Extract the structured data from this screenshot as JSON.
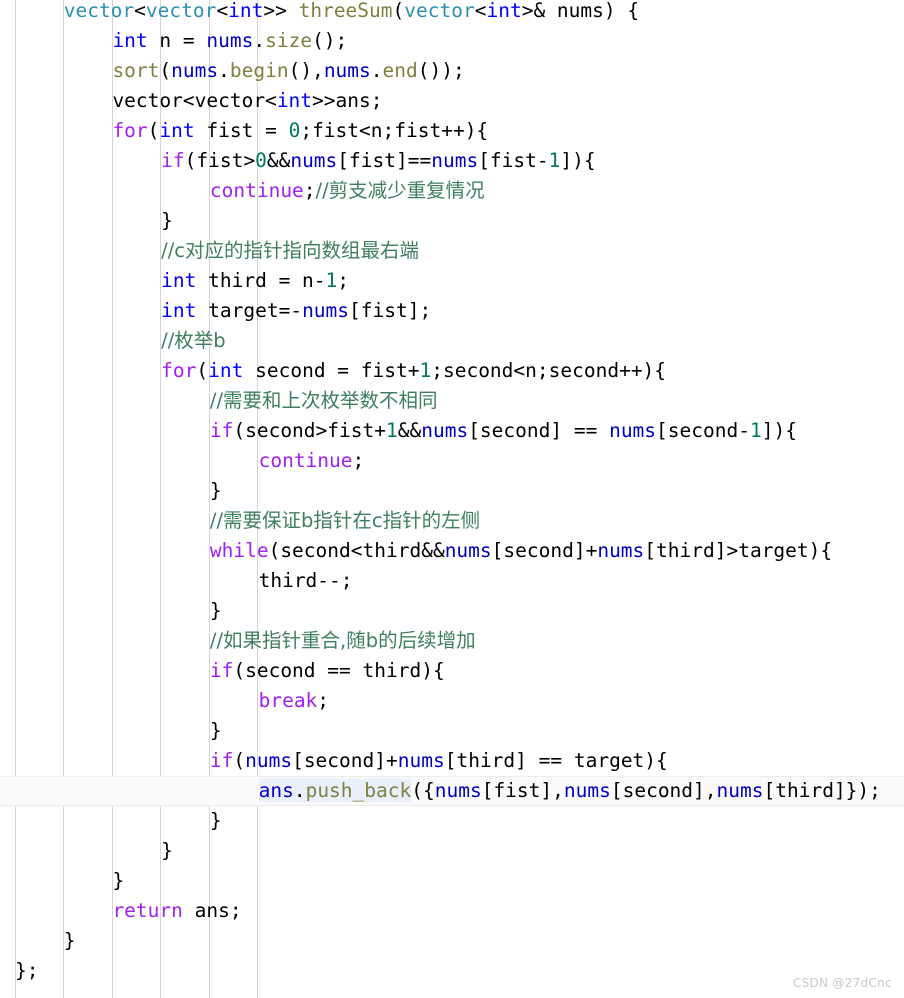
{
  "editor": {
    "language": "C++",
    "background_color": "#ffffff",
    "font_size_px": 19.5,
    "line_height_px": 30,
    "indent_guide_color": "#d4d4d4",
    "current_line_highlight_color": "#fafafa",
    "selection_highlight_color": "#eaf0fb",
    "first_line_clipped": true
  },
  "colors": {
    "keyword": "#a020f0",
    "type": "#0000ff",
    "class": "#2b91af",
    "function": "#7f7f3f",
    "variable": "#0000c0",
    "number": "#007a5e",
    "comment": "#3f7f5f",
    "default": "#000000",
    "watermark": "#c9c9c9"
  },
  "indent_guides": {
    "x_positions": [
      15,
      63,
      112,
      160,
      209,
      257
    ]
  },
  "watermark": {
    "text": "CSDN @27dCnc"
  },
  "code": {
    "plain_text": "    vector<vector<int>> threeSum(vector<int>& nums) {\n        int n = nums.size();\n        sort(nums.begin(),nums.end());\n        vector<vector<int>>ans;\n        for(int fist = 0;fist<n;fist++){\n            if(fist>0&&nums[fist]==nums[fist-1]){\n                continue;//剪支减少重复情况\n            }\n            //c对应的指针指向数组最右端\n            int third = n-1;\n            int target=-nums[fist];\n            //枚举b\n            for(int second = fist+1;second<n;second++){\n                //需要和上次枚举数不相同\n                if(second>fist+1&&nums[second] == nums[second-1]){\n                    continue;\n                }\n                //需要保证b指针在c指针的左侧\n                while(second<third&&nums[second]+nums[third]>target){\n                    third--;\n                }\n                //如果指针重合,随b的后续增加\n                if(second == third){\n                    break;\n                }\n                if(nums[second]+nums[third] == target){\n                    ans.push_back({nums[fist],nums[second],nums[third]});\n                }\n            }\n        }\n        return ans;\n    }\n};",
    "lines": [
      {
        "index": 0,
        "current": false,
        "indent": 4,
        "tokens": [
          {
            "t": "vector",
            "c": "cls"
          },
          {
            "t": "<",
            "c": "pun"
          },
          {
            "t": "vector",
            "c": "cls"
          },
          {
            "t": "<",
            "c": "pun"
          },
          {
            "t": "int",
            "c": "typ"
          },
          {
            "t": ">> ",
            "c": "pun"
          },
          {
            "t": "threeSum",
            "c": "fn"
          },
          {
            "t": "(",
            "c": "pun"
          },
          {
            "t": "vector",
            "c": "cls"
          },
          {
            "t": "<",
            "c": "pun"
          },
          {
            "t": "int",
            "c": "typ"
          },
          {
            "t": ">& nums) {",
            "c": "pun"
          }
        ]
      },
      {
        "index": 1,
        "current": false,
        "indent": 8,
        "tokens": [
          {
            "t": "int",
            "c": "typ"
          },
          {
            "t": " n = ",
            "c": "pun"
          },
          {
            "t": "nums",
            "c": "var"
          },
          {
            "t": ".",
            "c": "pun"
          },
          {
            "t": "size",
            "c": "fn"
          },
          {
            "t": "();",
            "c": "pun"
          }
        ]
      },
      {
        "index": 2,
        "current": false,
        "indent": 8,
        "tokens": [
          {
            "t": "sort",
            "c": "fn"
          },
          {
            "t": "(",
            "c": "pun"
          },
          {
            "t": "nums",
            "c": "var"
          },
          {
            "t": ".",
            "c": "pun"
          },
          {
            "t": "begin",
            "c": "fn"
          },
          {
            "t": "(),",
            "c": "pun"
          },
          {
            "t": "nums",
            "c": "var"
          },
          {
            "t": ".",
            "c": "pun"
          },
          {
            "t": "end",
            "c": "fn"
          },
          {
            "t": "());",
            "c": "pun"
          }
        ]
      },
      {
        "index": 3,
        "current": false,
        "indent": 8,
        "tokens": [
          {
            "t": "vector<vector<",
            "c": "pun"
          },
          {
            "t": "int",
            "c": "typ"
          },
          {
            "t": ">>ans;",
            "c": "pun"
          }
        ]
      },
      {
        "index": 4,
        "current": false,
        "indent": 8,
        "tokens": [
          {
            "t": "for",
            "c": "kw"
          },
          {
            "t": "(",
            "c": "pun"
          },
          {
            "t": "int",
            "c": "typ"
          },
          {
            "t": " fist = ",
            "c": "pun"
          },
          {
            "t": "0",
            "c": "num"
          },
          {
            "t": ";fist<n;fist++){",
            "c": "pun"
          }
        ]
      },
      {
        "index": 5,
        "current": false,
        "indent": 12,
        "tokens": [
          {
            "t": "if",
            "c": "kw"
          },
          {
            "t": "(fist>",
            "c": "pun"
          },
          {
            "t": "0",
            "c": "num"
          },
          {
            "t": "&&",
            "c": "pun"
          },
          {
            "t": "nums",
            "c": "var"
          },
          {
            "t": "[fist]==",
            "c": "pun"
          },
          {
            "t": "nums",
            "c": "var"
          },
          {
            "t": "[fist-",
            "c": "pun"
          },
          {
            "t": "1",
            "c": "num"
          },
          {
            "t": "]){",
            "c": "pun"
          }
        ]
      },
      {
        "index": 6,
        "current": false,
        "indent": 16,
        "tokens": [
          {
            "t": "continue",
            "c": "kw"
          },
          {
            "t": ";",
            "c": "pun"
          },
          {
            "t": "//剪支减少重复情况",
            "c": "cmt"
          }
        ]
      },
      {
        "index": 7,
        "current": false,
        "indent": 12,
        "tokens": [
          {
            "t": "}",
            "c": "pun"
          }
        ]
      },
      {
        "index": 8,
        "current": false,
        "indent": 12,
        "tokens": [
          {
            "t": "//c对应的指针指向数组最右端",
            "c": "cmt"
          }
        ]
      },
      {
        "index": 9,
        "current": false,
        "indent": 12,
        "tokens": [
          {
            "t": "int",
            "c": "typ"
          },
          {
            "t": " third = n-",
            "c": "pun"
          },
          {
            "t": "1",
            "c": "num"
          },
          {
            "t": ";",
            "c": "pun"
          }
        ]
      },
      {
        "index": 10,
        "current": false,
        "indent": 12,
        "tokens": [
          {
            "t": "int",
            "c": "typ"
          },
          {
            "t": " target=-",
            "c": "pun"
          },
          {
            "t": "nums",
            "c": "var"
          },
          {
            "t": "[fist];",
            "c": "pun"
          }
        ]
      },
      {
        "index": 11,
        "current": false,
        "indent": 12,
        "tokens": [
          {
            "t": "//枚举b",
            "c": "cmt"
          }
        ]
      },
      {
        "index": 12,
        "current": false,
        "indent": 12,
        "tokens": [
          {
            "t": "for",
            "c": "kw"
          },
          {
            "t": "(",
            "c": "pun"
          },
          {
            "t": "int",
            "c": "typ"
          },
          {
            "t": " second = fist+",
            "c": "pun"
          },
          {
            "t": "1",
            "c": "num"
          },
          {
            "t": ";second<n;second++){",
            "c": "pun"
          }
        ]
      },
      {
        "index": 13,
        "current": false,
        "indent": 16,
        "tokens": [
          {
            "t": "//需要和上次枚举数不相同",
            "c": "cmt"
          }
        ]
      },
      {
        "index": 14,
        "current": false,
        "indent": 16,
        "tokens": [
          {
            "t": "if",
            "c": "kw"
          },
          {
            "t": "(second>fist+",
            "c": "pun"
          },
          {
            "t": "1",
            "c": "num"
          },
          {
            "t": "&&",
            "c": "pun"
          },
          {
            "t": "nums",
            "c": "var"
          },
          {
            "t": "[second] == ",
            "c": "pun"
          },
          {
            "t": "nums",
            "c": "var"
          },
          {
            "t": "[second-",
            "c": "pun"
          },
          {
            "t": "1",
            "c": "num"
          },
          {
            "t": "]){",
            "c": "pun"
          }
        ]
      },
      {
        "index": 15,
        "current": false,
        "indent": 20,
        "tokens": [
          {
            "t": "continue",
            "c": "kw"
          },
          {
            "t": ";",
            "c": "pun"
          }
        ]
      },
      {
        "index": 16,
        "current": false,
        "indent": 16,
        "tokens": [
          {
            "t": "}",
            "c": "pun"
          }
        ]
      },
      {
        "index": 17,
        "current": false,
        "indent": 16,
        "tokens": [
          {
            "t": "//需要保证b指针在c指针的左侧",
            "c": "cmt"
          }
        ]
      },
      {
        "index": 18,
        "current": false,
        "indent": 16,
        "tokens": [
          {
            "t": "while",
            "c": "kw"
          },
          {
            "t": "(second<third",
            "c": "pun"
          },
          {
            "t": "&&",
            "c": "pun"
          },
          {
            "t": "nums",
            "c": "var"
          },
          {
            "t": "[second]+",
            "c": "pun"
          },
          {
            "t": "nums",
            "c": "var"
          },
          {
            "t": "[third]>target){",
            "c": "pun"
          }
        ]
      },
      {
        "index": 19,
        "current": false,
        "indent": 20,
        "tokens": [
          {
            "t": "third--;",
            "c": "pun"
          }
        ]
      },
      {
        "index": 20,
        "current": false,
        "indent": 16,
        "tokens": [
          {
            "t": "}",
            "c": "pun"
          }
        ]
      },
      {
        "index": 21,
        "current": false,
        "indent": 16,
        "tokens": [
          {
            "t": "//如果指针重合,随b的后续增加",
            "c": "cmt"
          }
        ]
      },
      {
        "index": 22,
        "current": false,
        "indent": 16,
        "tokens": [
          {
            "t": "if",
            "c": "kw"
          },
          {
            "t": "(second == third){",
            "c": "pun"
          }
        ]
      },
      {
        "index": 23,
        "current": false,
        "indent": 20,
        "tokens": [
          {
            "t": "break",
            "c": "kw"
          },
          {
            "t": ";",
            "c": "pun"
          }
        ]
      },
      {
        "index": 24,
        "current": false,
        "indent": 16,
        "tokens": [
          {
            "t": "}",
            "c": "pun"
          }
        ]
      },
      {
        "index": 25,
        "current": false,
        "indent": 16,
        "tokens": [
          {
            "t": "if",
            "c": "kw"
          },
          {
            "t": "(",
            "c": "pun"
          },
          {
            "t": "nums",
            "c": "var"
          },
          {
            "t": "[second]+",
            "c": "pun"
          },
          {
            "t": "nums",
            "c": "var"
          },
          {
            "t": "[third] == target){",
            "c": "pun"
          }
        ]
      },
      {
        "index": 26,
        "current": true,
        "indent": 20,
        "tokens": [
          {
            "t": "ans",
            "c": "var",
            "sel": true
          },
          {
            "t": ".",
            "c": "pun",
            "sel": true
          },
          {
            "t": "push_back",
            "c": "fn",
            "sel": true
          },
          {
            "t": "({",
            "c": "pun"
          },
          {
            "t": "nums",
            "c": "var"
          },
          {
            "t": "[fist],",
            "c": "pun"
          },
          {
            "t": "nums",
            "c": "var"
          },
          {
            "t": "[second],",
            "c": "pun"
          },
          {
            "t": "nums",
            "c": "var"
          },
          {
            "t": "[third]});",
            "c": "pun"
          }
        ]
      },
      {
        "index": 27,
        "current": false,
        "indent": 16,
        "tokens": [
          {
            "t": "}",
            "c": "pun"
          }
        ]
      },
      {
        "index": 28,
        "current": false,
        "indent": 12,
        "tokens": [
          {
            "t": "}",
            "c": "pun"
          }
        ]
      },
      {
        "index": 29,
        "current": false,
        "indent": 8,
        "tokens": [
          {
            "t": "}",
            "c": "pun"
          }
        ]
      },
      {
        "index": 30,
        "current": false,
        "indent": 8,
        "tokens": [
          {
            "t": "return",
            "c": "kw"
          },
          {
            "t": " ans;",
            "c": "pun"
          }
        ]
      },
      {
        "index": 31,
        "current": false,
        "indent": 4,
        "tokens": [
          {
            "t": "}",
            "c": "pun"
          }
        ]
      },
      {
        "index": 32,
        "current": false,
        "indent": 0,
        "tokens": [
          {
            "t": "};",
            "c": "pun"
          }
        ]
      }
    ]
  }
}
